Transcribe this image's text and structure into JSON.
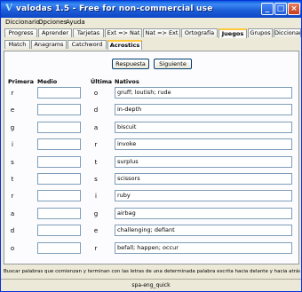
{
  "window": {
    "title": "valodas 1.5 - Free for non-commercial use",
    "app_icon": "V"
  },
  "menu": [
    "Diccionario",
    "Opciones",
    "Ayuda"
  ],
  "tabs": [
    "Progress",
    "Aprender",
    "Tarjetas",
    "Ext => Nat",
    "Nat => Ext",
    "Ortografía",
    "Juegos",
    "Grupos",
    "Diccionar"
  ],
  "subtabs": [
    "Match",
    "Anagrams",
    "Catchword",
    "Acrostics"
  ],
  "buttons": {
    "answer": "Respuesta",
    "next": "Siguiente"
  },
  "headers": {
    "first": "Primera",
    "middle": "Medio",
    "last": "Última",
    "native": "Nativos"
  },
  "rows": [
    {
      "first": "r",
      "middle": "",
      "last": "o",
      "native": "gruff; loutish; rude"
    },
    {
      "first": "e",
      "middle": "",
      "last": "d",
      "native": "in-depth"
    },
    {
      "first": "g",
      "middle": "",
      "last": "a",
      "native": "biscuit"
    },
    {
      "first": "i",
      "middle": "",
      "last": "r",
      "native": "invoke"
    },
    {
      "first": "s",
      "middle": "",
      "last": "t",
      "native": "surplus"
    },
    {
      "first": "t",
      "middle": "",
      "last": "s",
      "native": "scissors"
    },
    {
      "first": "r",
      "middle": "",
      "last": "i",
      "native": "ruby"
    },
    {
      "first": "a",
      "middle": "",
      "last": "g",
      "native": "airbag"
    },
    {
      "first": "d",
      "middle": "",
      "last": "e",
      "native": "challenging; defiant"
    },
    {
      "first": "o",
      "middle": "",
      "last": "r",
      "native": "befall; happen; occur"
    }
  ],
  "status_text": "Buscar palabras que comienzan y terminan con las letras de una determinada palabra escrita hacia delante y hacia atrás. Pulse F1 pa",
  "statusbar": {
    "dictionary": "spa-eng_quick"
  }
}
